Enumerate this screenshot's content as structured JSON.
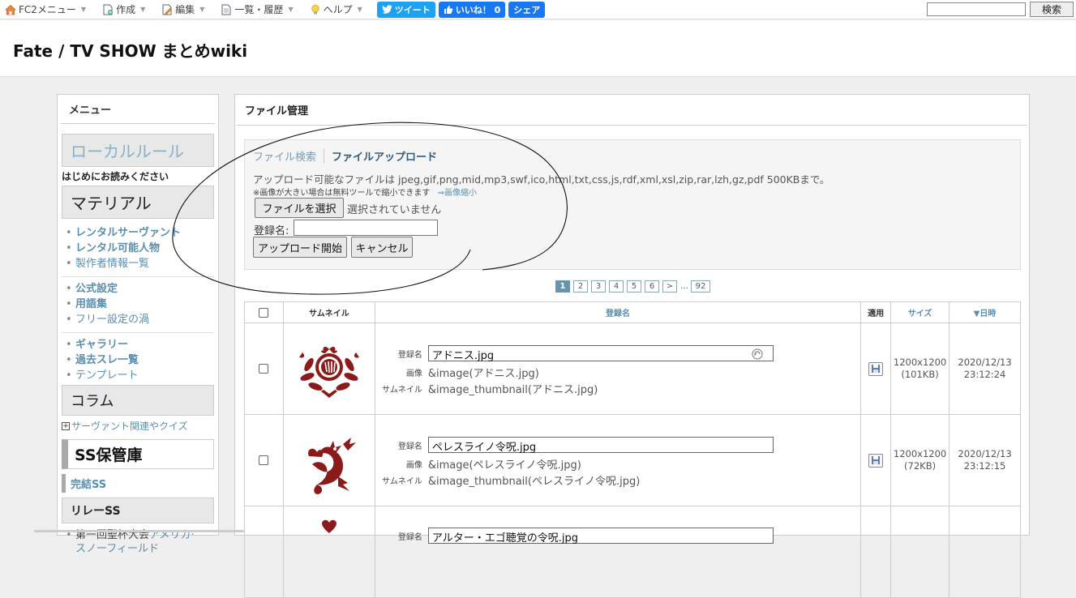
{
  "toolbar": {
    "fc2_menu": "FC2メニュー",
    "create": "作成",
    "edit": "編集",
    "list": "一覧・履歴",
    "help": "ヘルプ",
    "tweet": "ツイート",
    "like": "いいね！ 0",
    "share": "シェア",
    "search_button": "検索",
    "search_value": ""
  },
  "header": {
    "title": "Fate / TV SHOW まとめwiki"
  },
  "sidebar": {
    "heading": "メニュー",
    "local_rule": "ローカルルール",
    "read_first": "はじめにお読みください",
    "material": "マテリアル",
    "group1": [
      "レンタルサーヴァント",
      "レンタル可能人物",
      "製作者情報一覧"
    ],
    "group2": [
      "公式設定",
      "用語集",
      "フリー設定の渦"
    ],
    "group3": [
      "ギャラリー",
      "過去スレ一覧",
      "テンプレート"
    ],
    "column": "コラム",
    "column_sub": "サーヴァント関連やクイズ",
    "ss_storage": "SS保管庫",
    "ss_done": "完結SS",
    "relay_ss": "リレーSS",
    "relay_item_prefix": "第一回聖杯大会",
    "relay_item_link": "アメリカ·スノーフィールド"
  },
  "main": {
    "heading": "ファイル管理",
    "tab_search": "ファイル検索",
    "tab_upload": "ファイルアップロード",
    "upload_desc": "アップロード可能なファイルは jpeg,gif,png,mid,mp3,swf,ico,html,txt,css,js,rdf,xml,xsl,zip,rar,lzh,gz,pdf 500KBまで。",
    "upload_note": "※画像が大きい場合は無料ツールで縮小できます",
    "resize_link": "⇒画像縮小",
    "choose_file": "ファイルを選択",
    "no_file": "選択されていません",
    "reg_label": "登録名:",
    "reg_value": "",
    "start_upload": "アップロード開始",
    "cancel": "キャンセル"
  },
  "pager": {
    "pages": [
      "1",
      "2",
      "3",
      "4",
      "5",
      "6"
    ],
    "next": ">",
    "ellipsis": "…",
    "last": "92",
    "current": "1"
  },
  "table": {
    "headers": {
      "thumb": "サムネイル",
      "name": "登録名",
      "apply": "適用",
      "size": "サイズ",
      "date": "▼日時"
    },
    "label_name": "登録名",
    "label_image": "画像",
    "label_thumb": "サムネイル",
    "rows": [
      {
        "name": "アドニス.jpg",
        "image": "&image(アドニス.jpg)",
        "thumb": "&image_thumbnail(アドニス.jpg)",
        "dims": "1200x1200",
        "kb": "(101KB)",
        "date": "2020/12/13",
        "time": "23:12:24"
      },
      {
        "name": "ペレスライノ令呪.jpg",
        "image": "&image(ペレスライノ令呪.jpg)",
        "thumb": "&image_thumbnail(ペレスライノ令呪.jpg)",
        "dims": "1200x1200",
        "kb": "(72KB)",
        "date": "2020/12/13",
        "time": "23:12:15"
      },
      {
        "name": "アルター・エゴ聴覚の令呪.jpg"
      }
    ]
  },
  "colors": {
    "accent": "#5a8fb0",
    "seal_red": "#8b1a1a",
    "tweet": "#1da1f2",
    "facebook": "#1877f2"
  }
}
